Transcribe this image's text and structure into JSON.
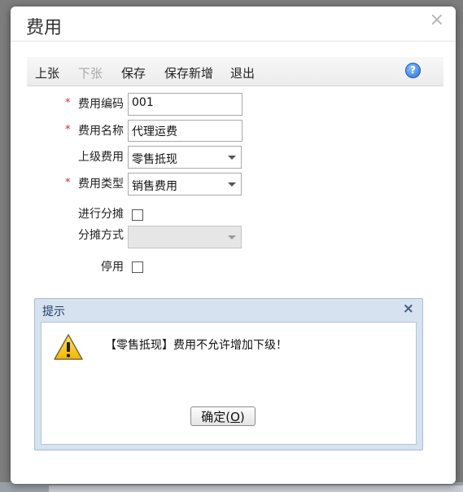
{
  "dialog": {
    "title": "费用",
    "close_glyph": "×"
  },
  "toolbar": {
    "prev_label": "上张",
    "next_label": "下张",
    "save_label": "保存",
    "save_new_label": "保存新增",
    "exit_label": "退出",
    "help_glyph": "?"
  },
  "form": {
    "required_mark": "*",
    "code": {
      "label": "费用编码",
      "value": "001",
      "required": true
    },
    "name": {
      "label": "费用名称",
      "value": "代理运费",
      "required": true
    },
    "parent": {
      "label": "上级费用",
      "value": "零售抵现",
      "required": false
    },
    "type": {
      "label": "费用类型",
      "value": "销售费用",
      "required": true
    },
    "allocate": {
      "label": "进行分摊",
      "checked": false
    },
    "allocation_method": {
      "label": "分摊方式",
      "value": "",
      "disabled": true
    },
    "disabled_flag": {
      "label": "停用",
      "checked": false
    }
  },
  "alert": {
    "title": "提示",
    "close_glyph": "×",
    "icon": "warning-icon",
    "message": "【零售抵现】费用不允许增加下级！",
    "ok_label": "确定(O)"
  },
  "colors": {
    "required": "#cc2b2b",
    "alert_header": "#d6e2f0",
    "help_icon": "#2a6ed4"
  }
}
